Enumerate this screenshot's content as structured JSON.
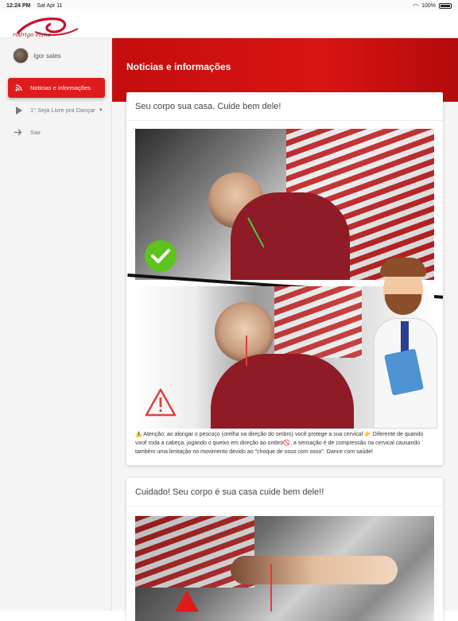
{
  "status_bar": {
    "time": "12:24 PM",
    "date": "Sat Apr 11",
    "battery": "100%"
  },
  "brand": {
    "logo_text": "rodrigo  elano"
  },
  "user": {
    "name": "Igor sales"
  },
  "sidebar": {
    "items": [
      {
        "label": "Noticias e informações",
        "icon": "rss-icon",
        "active": true
      },
      {
        "label": "1° Seja Livre pra Dançar",
        "icon": "play-icon",
        "active": false
      },
      {
        "label": "Sair",
        "icon": "arrow-right-icon",
        "active": false
      }
    ]
  },
  "page": {
    "title": "Noticias e informações"
  },
  "posts": [
    {
      "title": "Seu corpo sua casa. Cuide bem dele!",
      "body": "⚠️ Atenção: ao alongar o pescoço (orelha na direção do ombro) você protege a sua cervical 👉 Diferente de quando você roda a cabeça, jogando o queixo em direção ao ombro🚫, a sensação é de compressão na cervical causando também uma limitação no movimento devido ao \"choque de osso com osso\". Dance com saúde!"
    },
    {
      "title": "Cuidado! Seu corpo é sua casa cuide bem dele!!"
    }
  ],
  "colors": {
    "accent": "#e01b1b",
    "hero": "#c40d0d",
    "check": "#5cc41c"
  }
}
